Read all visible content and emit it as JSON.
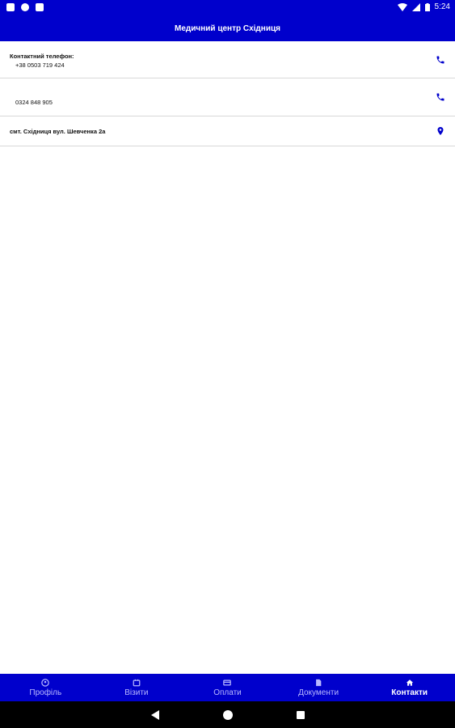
{
  "status_bar": {
    "time": "5:24"
  },
  "header": {
    "title": "Медичний центр Східниця"
  },
  "contacts": [
    {
      "label": "Контактний телефон:",
      "value": "+38 0503 719 424",
      "icon": "phone-icon"
    },
    {
      "label": "",
      "value": "0324 848 905",
      "icon": "phone-icon"
    },
    {
      "label": "смт. Східниця вул. Шевченка 2а",
      "value": "",
      "icon": "location-pin-icon"
    }
  ],
  "bottom_nav": {
    "items": [
      {
        "label": "Профіль",
        "icon": "profile-icon",
        "active": false
      },
      {
        "label": "Візити",
        "icon": "calendar-icon",
        "active": false
      },
      {
        "label": "Оплати",
        "icon": "card-icon",
        "active": false
      },
      {
        "label": "Документи",
        "icon": "document-icon",
        "active": false
      },
      {
        "label": "Контакти",
        "icon": "home-icon",
        "active": true
      }
    ]
  },
  "colors": {
    "primary": "#0000cc",
    "inactive_nav": "#b8b8ff"
  }
}
